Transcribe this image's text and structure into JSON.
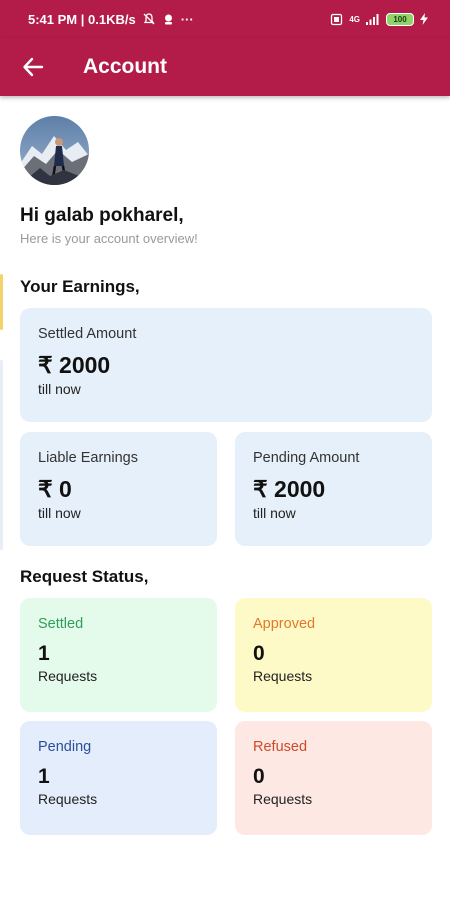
{
  "status_bar": {
    "time_info": "5:41 PM | 0.1KB/s",
    "more": "···",
    "network": "4G",
    "battery": "100"
  },
  "app_bar": {
    "title": "Account"
  },
  "greeting": {
    "title": "Hi galab pokharel,",
    "subtitle": "Here is your account overview!"
  },
  "earnings": {
    "title": "Your Earnings,",
    "settled": {
      "label": "Settled Amount",
      "amount": "₹ 2000",
      "sub": "till now"
    },
    "liable": {
      "label": "Liable Earnings",
      "amount": "₹ 0",
      "sub": "till now"
    },
    "pending": {
      "label": "Pending Amount",
      "amount": "₹ 2000",
      "sub": "till now"
    }
  },
  "requests": {
    "title": "Request Status,",
    "items": [
      {
        "label": "Settled",
        "count": "1",
        "sub": "Requests",
        "bg": "#e4fbeb",
        "color": "#2e9e5a"
      },
      {
        "label": "Approved",
        "count": "0",
        "sub": "Requests",
        "bg": "#fefac8",
        "color": "#e0792b"
      },
      {
        "label": "Pending",
        "count": "1",
        "sub": "Requests",
        "bg": "#e3edfb",
        "color": "#2c4f9c"
      },
      {
        "label": "Refused",
        "count": "0",
        "sub": "Requests",
        "bg": "#fde8e4",
        "color": "#cf4a2a"
      }
    ]
  },
  "colors": {
    "primary": "#b31b49",
    "card_blue": "#e6f0fa"
  }
}
